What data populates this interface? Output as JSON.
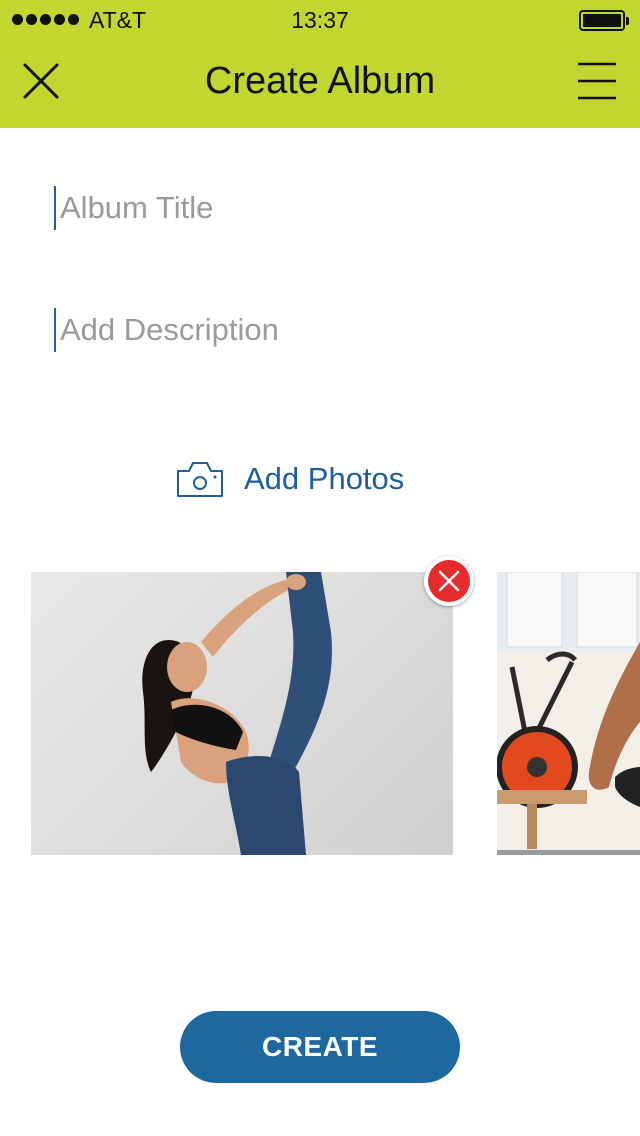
{
  "status_bar": {
    "carrier": "AT&T",
    "time": "13:37",
    "battery_level": 0.95
  },
  "nav": {
    "title": "Create Album",
    "close_icon": "close-icon",
    "menu_icon": "hamburger-menu-icon"
  },
  "form": {
    "title_placeholder": "Album Title",
    "title_value": "",
    "description_placeholder": "Add Description",
    "description_value": ""
  },
  "add_photos": {
    "label": "Add Photos",
    "icon": "camera-icon"
  },
  "photos": [
    {
      "subject": "dancer-photo",
      "removable": true
    },
    {
      "subject": "gym-photo",
      "removable": false
    }
  ],
  "remove_icon": "remove-x-icon",
  "create_button": {
    "label": "CREATE"
  },
  "colors": {
    "header_bg": "#bfd72f",
    "accent_blue": "#1d689f",
    "remove_red": "#e52b2b",
    "placeholder_gray": "#9a9a9a"
  }
}
